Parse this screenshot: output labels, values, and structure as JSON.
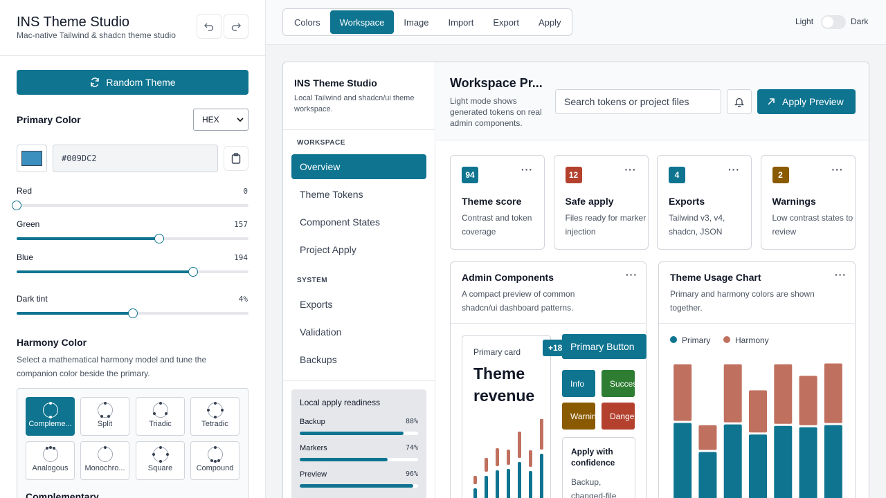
{
  "app": {
    "title": "INS Theme Studio",
    "subtitle": "Mac-native Tailwind & shadcn theme studio"
  },
  "left": {
    "random_label": "Random Theme",
    "primary_label": "Primary Color",
    "format_value": "HEX",
    "hex_value": "#009DC2",
    "swatch_color": "#3b8fbf",
    "sliders": [
      {
        "label": "Red",
        "value": "0",
        "fraction": 0.0
      },
      {
        "label": "Green",
        "value": "157",
        "fraction": 0.615
      },
      {
        "label": "Blue",
        "value": "194",
        "fraction": 0.761
      }
    ],
    "dark_tint": {
      "label": "Dark tint",
      "value": "4%",
      "fraction": 0.5
    },
    "harmony_title": "Harmony Color",
    "harmony_desc": "Select a mathematical harmony model and tune the companion color beside the primary.",
    "harmony_options": [
      "Compleme...",
      "Split",
      "Triadic",
      "Tetradic",
      "Analogous",
      "Monochro...",
      "Square",
      "Compound"
    ],
    "harmony_selected": "Complementary"
  },
  "top": {
    "tabs": [
      "Colors",
      "Workspace",
      "Image",
      "Import",
      "Export",
      "Apply"
    ],
    "active_tab": "Workspace",
    "mode_light": "Light",
    "mode_dark": "Dark"
  },
  "nav": {
    "title": "INS Theme Studio",
    "desc": "Local Tailwind and shadcn/ui theme workspace.",
    "workspace_label": "WORKSPACE",
    "workspace_items": [
      "Overview",
      "Theme Tokens",
      "Component States",
      "Project Apply"
    ],
    "system_label": "SYSTEM",
    "system_items": [
      "Exports",
      "Validation",
      "Backups"
    ],
    "readiness": {
      "title": "Local apply readiness",
      "rows": [
        {
          "name": "Backup",
          "pct": "88%",
          "fraction": 0.88
        },
        {
          "name": "Markers",
          "pct": "74%",
          "fraction": 0.74
        },
        {
          "name": "Preview",
          "pct": "96%",
          "fraction": 0.96
        }
      ]
    }
  },
  "preview": {
    "title": "Workspace Pr...",
    "desc": "Light mode shows generated tokens on real admin components.",
    "search_placeholder": "Search tokens or project files",
    "apply_label": "Apply Preview",
    "stats": [
      {
        "value": "94",
        "title": "Theme score",
        "desc": "Contrast and token coverage",
        "color": "#0e7490"
      },
      {
        "value": "12",
        "title": "Safe apply",
        "desc": "Files ready for marker injection",
        "color": "#b3412e"
      },
      {
        "value": "4",
        "title": "Exports",
        "desc": "Tailwind v3, v4, shadcn, JSON",
        "color": "#0e7490"
      },
      {
        "value": "2",
        "title": "Warnings",
        "desc": "Low contrast states to review",
        "color": "#8a5a00"
      }
    ],
    "admin": {
      "title": "Admin Components",
      "desc": "A compact preview of common shadcn/ui dashboard patterns.",
      "primary_card_label": "Primary card",
      "primary_card_big": "Theme revenue",
      "badge": "+18",
      "primary_button": "Primary Button",
      "pills": [
        {
          "label": "Info",
          "color": "#0e7490"
        },
        {
          "label": "Success",
          "color": "#2e7d32"
        },
        {
          "label": "Warning",
          "color": "#8a5a00"
        },
        {
          "label": "Danger",
          "color": "#b3412e"
        }
      ],
      "confidence_title": "Apply with confidence",
      "confidence_desc": "Backup, changed-file"
    },
    "usage": {
      "title": "Theme Usage Chart",
      "desc": "Primary and harmony colors are shown together.",
      "legend_primary": "Primary",
      "legend_harmony": "Harmony",
      "primary_color": "#0e7490",
      "harmony_color": "#c0705f"
    }
  },
  "chart_data": [
    {
      "type": "bar",
      "series": [
        {
          "name": "Primary",
          "values": [
            110,
            70,
            108,
            94,
            106,
            104,
            107
          ]
        },
        {
          "name": "Harmony",
          "values": [
            78,
            34,
            80,
            58,
            82,
            68,
            82
          ]
        }
      ],
      "ylim": [
        0,
        200
      ]
    },
    {
      "type": "bar",
      "series": [
        {
          "values": [
            20,
            38,
            46,
            48,
            58,
            45,
            70
          ]
        },
        {
          "values": [
            12,
            20,
            26,
            22,
            38,
            24,
            46
          ]
        }
      ],
      "ylim": [
        0,
        120
      ]
    }
  ]
}
